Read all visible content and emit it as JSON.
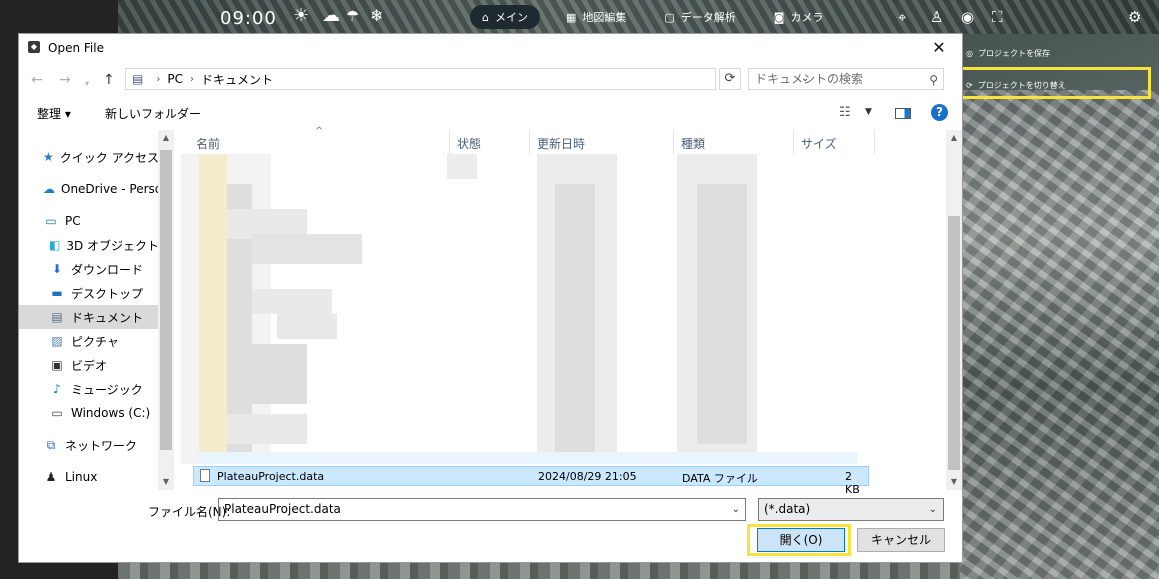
{
  "app": {
    "clock": "09:00",
    "weather_icons": [
      "sun-icon",
      "umbrella-icon",
      "snowflake-icon"
    ],
    "tabs": [
      {
        "icon": "home-icon",
        "label": "メイン",
        "active": true
      },
      {
        "icon": "map-edit-icon",
        "label": "地図編集",
        "active": false
      },
      {
        "icon": "data-analysis-icon",
        "label": "データ解析",
        "active": false
      },
      {
        "icon": "camera-icon",
        "label": "カメラ",
        "active": false
      }
    ],
    "side_panel": {
      "save_project": "プロジェクトを保存",
      "switch_project": "プロジェクトを切り替え"
    },
    "highlight_color": "#f6e43a"
  },
  "dialog": {
    "title": "Open File",
    "breadcrumb": [
      "PC",
      "ドキュメント"
    ],
    "search_placeholder": "ドキュメントの検索",
    "organize_label": "整理 ▾",
    "new_folder_label": "新しいフォルダー",
    "nav_items": [
      {
        "icon": "star-icon",
        "label": "クイック アクセス"
      },
      {
        "icon": "cloud-icon",
        "label": "OneDrive - Personal"
      },
      {
        "icon": "pc-icon",
        "label": "PC"
      },
      {
        "icon": "cube-icon",
        "label": "3D オブジェクト"
      },
      {
        "icon": "download-icon",
        "label": "ダウンロード"
      },
      {
        "icon": "desktop-icon",
        "label": "デスクトップ"
      },
      {
        "icon": "document-icon",
        "label": "ドキュメント",
        "selected": true
      },
      {
        "icon": "picture-icon",
        "label": "ピクチャ"
      },
      {
        "icon": "video-icon",
        "label": "ビデオ"
      },
      {
        "icon": "music-icon",
        "label": "ミュージック"
      },
      {
        "icon": "drive-icon",
        "label": "Windows (C:)"
      },
      {
        "icon": "network-icon",
        "label": "ネットワーク"
      },
      {
        "icon": "linux-icon",
        "label": "Linux"
      }
    ],
    "columns": [
      "名前",
      "状態",
      "更新日時",
      "種類",
      "サイズ"
    ],
    "selected_file": {
      "name": "PlateauProject.data",
      "modified": "2024/08/29 21:05",
      "type": "DATA ファイル",
      "size": "2 KB"
    },
    "filename_label": "ファイル名(N):",
    "filename_value": "PlateauProject.data",
    "filter_value": "(*.data)",
    "open_label": "開く(O)",
    "cancel_label": "キャンセル"
  }
}
